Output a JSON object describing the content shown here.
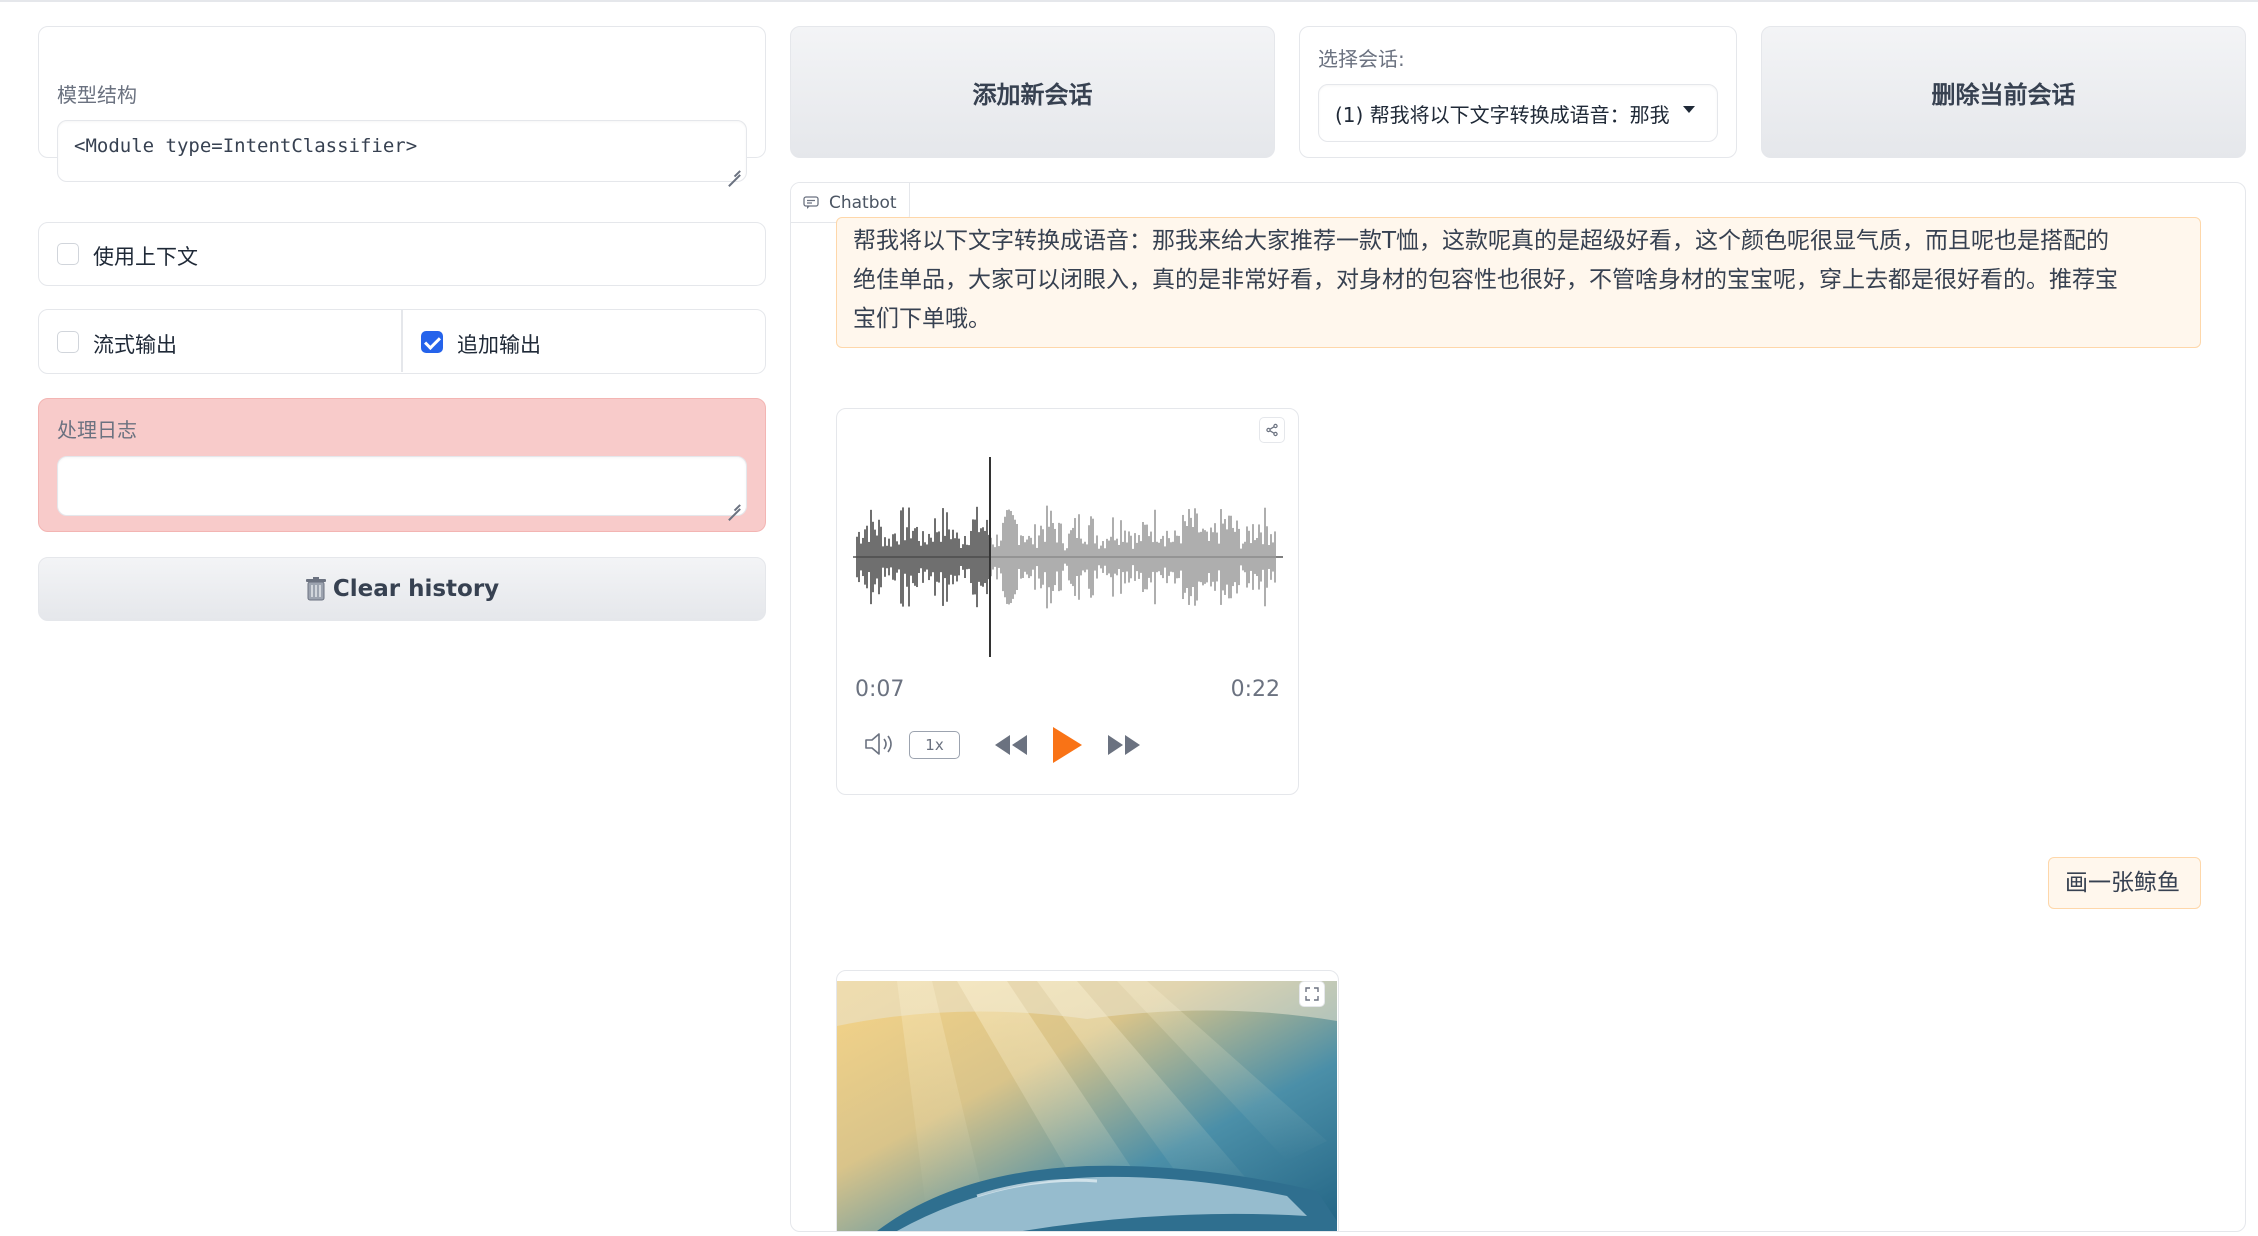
{
  "left": {
    "model_label": "模型结构",
    "model_value": "<Module type=IntentClassifier>",
    "use_context_label": "使用上下文",
    "stream_output_label": "流式输出",
    "append_output_label": "追加输出",
    "log_label": "处理日志",
    "log_value": "",
    "clear_history_label": "Clear history",
    "clear_history_icon": "trash-icon"
  },
  "top": {
    "add_session_label": "添加新会话",
    "select_session_label": "选择会话:",
    "select_session_value": "(1) 帮我将以下文字转换成语音：那我",
    "delete_session_label": "删除当前会话"
  },
  "chat": {
    "tag_label": "Chatbot",
    "messages": [
      {
        "role": "user",
        "text_lines": [
          "帮我将以下文字转换成语音：那我来给大家推荐一款T恤，这款呢真的是超级好看，这个颜色呢很显气质，而且呢也是搭配的",
          "绝佳单品，大家可以闭眼入，真的是非常好看，对身材的包容性也很好，不管啥身材的宝宝呢，穿上去都是很好看的。推荐宝",
          "宝们下单哦。"
        ]
      },
      {
        "role": "bot",
        "type": "audio",
        "current_time": "0:07",
        "duration": "0:22",
        "speed": "1x",
        "progress": 0.318
      },
      {
        "role": "user",
        "text": "画一张鲸鱼"
      },
      {
        "role": "bot",
        "type": "image"
      }
    ]
  },
  "colors": {
    "accent": "#f97316",
    "checkbox": "#2563eb",
    "log_bg": "#f8cbca"
  }
}
